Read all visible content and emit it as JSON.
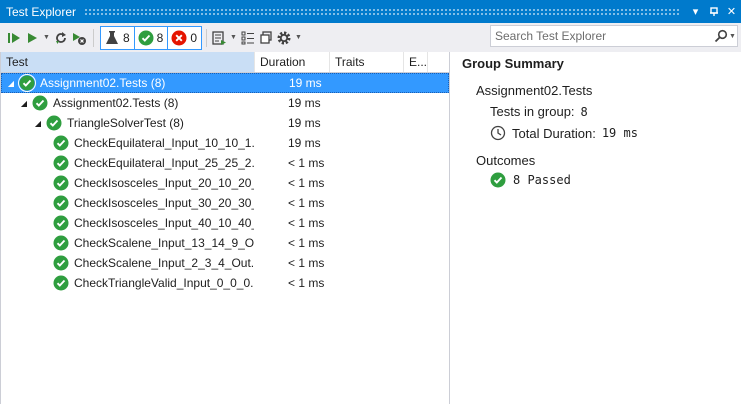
{
  "window": {
    "title": "Test Explorer",
    "buttons": {
      "dropdown": "▾",
      "pin": "⊓",
      "close": "✕"
    }
  },
  "toolbar": {
    "filters": [
      {
        "name": "all",
        "count": "8"
      },
      {
        "name": "passed",
        "count": "8"
      },
      {
        "name": "failed",
        "count": "0"
      }
    ],
    "search_placeholder": "Search Test Explorer"
  },
  "columns": {
    "test": "Test",
    "duration": "Duration",
    "traits": "Traits",
    "e": "E..."
  },
  "tree": [
    {
      "name": "Assignment02.Tests  (8)",
      "duration": "19 ms",
      "level": 0,
      "expanded": true,
      "selected": true
    },
    {
      "name": "Assignment02.Tests  (8)",
      "duration": "19 ms",
      "level": 1,
      "expanded": true,
      "selected": false
    },
    {
      "name": "TriangleSolverTest  (8)",
      "duration": "19 ms",
      "level": 2,
      "expanded": true,
      "selected": false
    },
    {
      "name": "CheckEquilateral_Input_10_10_1...",
      "duration": "19 ms",
      "level": 3
    },
    {
      "name": "CheckEquilateral_Input_25_25_2...",
      "duration": "< 1 ms",
      "level": 3
    },
    {
      "name": "CheckIsosceles_Input_20_10_20_...",
      "duration": "< 1 ms",
      "level": 3
    },
    {
      "name": "CheckIsosceles_Input_30_20_30_...",
      "duration": "< 1 ms",
      "level": 3
    },
    {
      "name": "CheckIsosceles_Input_40_10_40_...",
      "duration": "< 1 ms",
      "level": 3
    },
    {
      "name": "CheckScalene_Input_13_14_9_O...",
      "duration": "< 1 ms",
      "level": 3
    },
    {
      "name": "CheckScalene_Input_2_3_4_Out...",
      "duration": "< 1 ms",
      "level": 3
    },
    {
      "name": "CheckTriangleValid_Input_0_0_0...",
      "duration": "< 1 ms",
      "level": 3
    }
  ],
  "summary": {
    "title": "Group Summary",
    "group": "Assignment02.Tests",
    "tests_label": "Tests in group:",
    "tests_value": "8",
    "duration_label": "Total Duration:",
    "duration_value": "19 ms",
    "outcomes_label": "Outcomes",
    "passed_text": "8 Passed"
  },
  "colors": {
    "accent": "#007acc",
    "selection": "#3399ff",
    "pass": "#2f9e3f",
    "fail": "#e51400"
  }
}
